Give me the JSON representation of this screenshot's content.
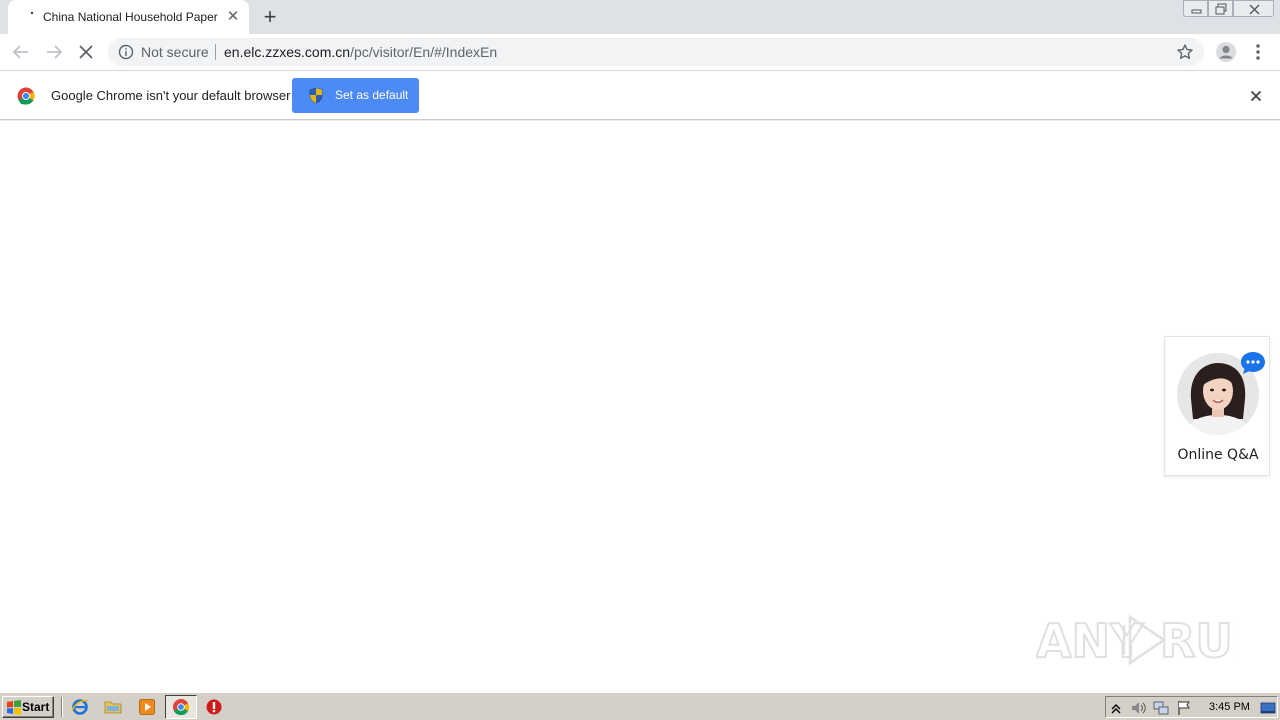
{
  "browser": {
    "tab": {
      "title": "China National Household Paper Industry",
      "close_icon": "close-icon",
      "favicon": "loading-dot-icon"
    },
    "new_tab_icon": "plus-icon",
    "window_controls": [
      "minimize-icon",
      "restore-icon",
      "close-icon"
    ],
    "toolbar": {
      "back_icon": "arrow-left-icon",
      "forward_icon": "arrow-right-icon",
      "stop_icon": "close-icon",
      "security_label": "Not secure",
      "url_host": "en.elc.zzxes.com.cn",
      "url_path": "/pc/visitor/En/#/IndexEn",
      "bookmark_icon": "star-icon",
      "profile_icon": "person-icon",
      "menu_icon": "kebab-menu-icon"
    },
    "infobar": {
      "message": "Google Chrome isn't your default browser",
      "button_label": "Set as default",
      "button_icon": "uac-shield-icon",
      "close_icon": "close-icon"
    }
  },
  "page": {
    "qa_widget": {
      "label": "Online Q&A",
      "avatar": "support-agent-avatar",
      "badge_icon": "chat-bubble-icon"
    },
    "watermark": "ANY RUN"
  },
  "taskbar": {
    "start_label": "Start",
    "quick_launch": [
      "internet-explorer-icon",
      "explorer-folder-icon",
      "media-player-icon",
      "chrome-icon",
      "stop-sign-icon"
    ],
    "tray_icons": [
      "chevron-up-icon",
      "speaker-icon",
      "network-icon",
      "flag-icon",
      "desktop-icon"
    ],
    "clock": "3:45 PM"
  },
  "colors": {
    "accent_blue": "#4c8bf5",
    "tab_strip": "#dee1e6",
    "omnibox": "#f1f3f4",
    "taskbar": "#d4d0c8"
  }
}
